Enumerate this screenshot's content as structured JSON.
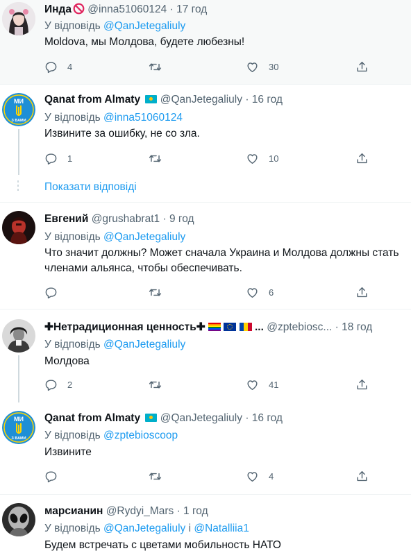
{
  "reply_prefix": "У відповідь",
  "reply_conjunction": "і",
  "show_replies_label": "Показати відповіді",
  "tweets": [
    {
      "name": "Инда",
      "name_emoji": "prohibited-icon",
      "handle": "@inna51060124",
      "time": "17 год",
      "reply_to": "@QanJetegaliuly",
      "text": "Moldova, мы Молдова, будете любезны!",
      "replies": "4",
      "retweets": "",
      "likes": "30"
    },
    {
      "name": "Qanat from Almaty",
      "name_emoji": "kazakhstan-flag-icon",
      "handle": "@QanJetegaliuly",
      "time": "16 год",
      "reply_to": "@inna51060124",
      "text": "Извините за ошибку, не со зла.",
      "replies": "1",
      "retweets": "",
      "likes": "10"
    },
    {
      "name": "Евгений",
      "handle": "@grushabrat1",
      "time": "9 год",
      "reply_to": "@QanJetegaliuly",
      "text": "Что значит должны? Может сначала Украина и Молдова должны стать членами альянса, чтобы обеспечивать.",
      "replies": "",
      "retweets": "",
      "likes": "6"
    },
    {
      "name": "✚Нетрадиционная ценность✚",
      "name_emoji": "rainbow-eu-moldova-flags",
      "handle": "@zptebiosc...",
      "time": "18 год",
      "reply_to": "@QanJetegaliuly",
      "text": "Молдова",
      "replies": "2",
      "retweets": "",
      "likes": "41"
    },
    {
      "name": "Qanat from Almaty",
      "name_emoji": "kazakhstan-flag-icon",
      "handle": "@QanJetegaliuly",
      "time": "16 год",
      "reply_to": "@zptebioscoop",
      "text": "Извините",
      "replies": "",
      "retweets": "",
      "likes": "4"
    },
    {
      "name": "марсианин",
      "handle": "@Rydyi_Mars",
      "time": "1 год",
      "reply_to": "@QanJetegaliuly",
      "reply_to_2": "@Natalliia1",
      "text": "Будем встречать с цветами мобильность НАТО"
    }
  ],
  "avatar_badge_top": "МИ",
  "avatar_badge_bottom": "З ВАМИ",
  "colors": {
    "link": "#1d9bf0",
    "secondary_text": "#536471",
    "highlight_bg": "#f7f9f9",
    "border": "#eff3f4",
    "avatar_badge_bg": "#1f8fd6"
  }
}
